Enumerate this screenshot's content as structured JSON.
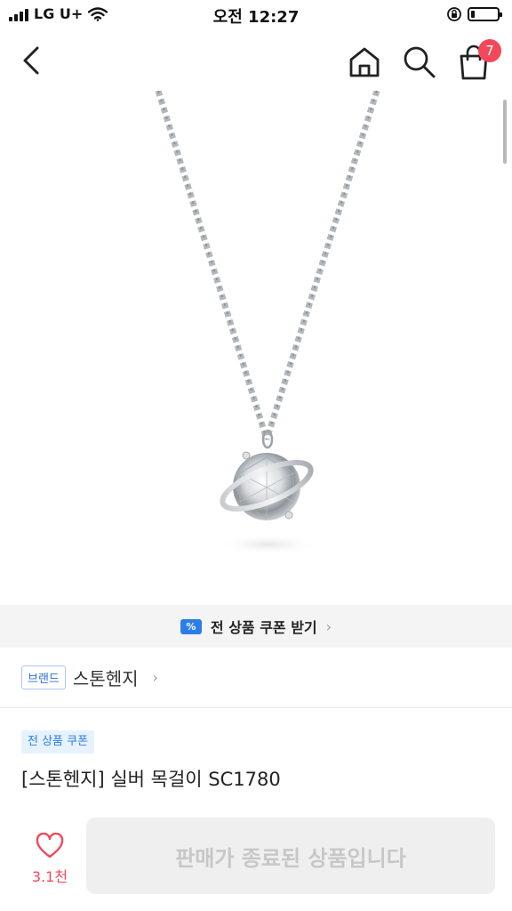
{
  "status_bar": {
    "carrier": "LG U+",
    "time": "오전 12:27",
    "battery_level": 0.15
  },
  "nav": {
    "back_icon": "chevron-left-icon",
    "home_icon": "home-icon",
    "search_icon": "search-icon",
    "cart_icon": "shopping-bag-icon",
    "cart_count": "7"
  },
  "coupon_banner": {
    "icon": "coupon-icon",
    "icon_glyph": "%",
    "label": "전 상품 쿠폰 받기",
    "chevron": "›"
  },
  "brand": {
    "tag": "브랜드",
    "name": "스톤헨지",
    "chevron": "›"
  },
  "product": {
    "coupon_tag": "전 상품 쿠폰",
    "title": "[스톤헨지] 실버 목걸이 SC1780"
  },
  "actions": {
    "wish_icon": "heart-icon",
    "wish_count": "3.1천",
    "sold_out_label": "판매가 종료된 상품입니다"
  },
  "colors": {
    "accent_red": "#f4475a",
    "accent_blue": "#2b7de9",
    "button_disabled_bg": "#efefef"
  }
}
